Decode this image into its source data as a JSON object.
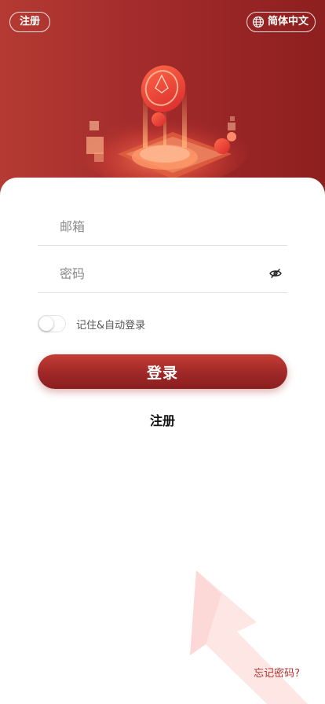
{
  "header": {
    "register_label": "注册",
    "language_label": "简体中文",
    "language_icon": "globe-icon"
  },
  "form": {
    "email_placeholder": "邮箱",
    "password_placeholder": "密码",
    "password_toggle_icon": "eye-off-icon",
    "remember_label": "记住&自动登录",
    "remember_enabled": false
  },
  "actions": {
    "login_label": "登录",
    "register_label": "注册",
    "forgot_label": "忘记密码?"
  },
  "colors": {
    "brand": "#a22b2b",
    "accent_text": "#b1322d"
  }
}
